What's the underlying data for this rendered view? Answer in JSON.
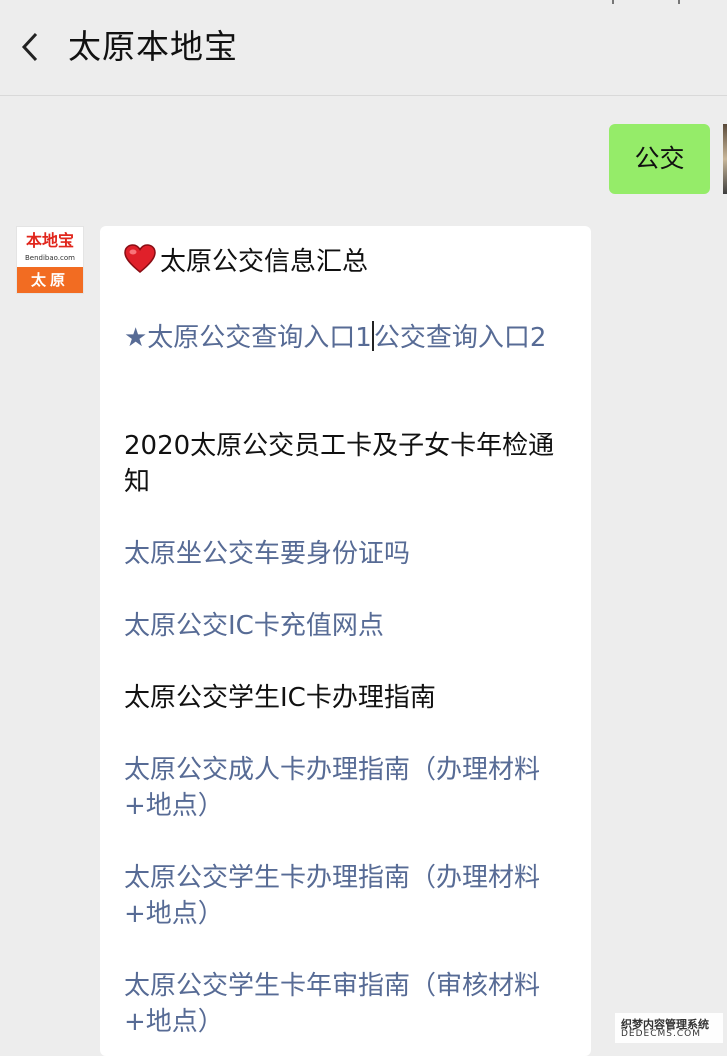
{
  "header": {
    "title": "太原本地宝",
    "back_icon": "chevron-left-icon"
  },
  "sent_message": {
    "text": "公交",
    "bubble_color": "#95ec69"
  },
  "sender": {
    "logo_text": "本地宝",
    "logo_sub": "Bendibao.com",
    "city_label": "太原",
    "brand_color": "#f26c22"
  },
  "received": {
    "header_emoji": "heart-icon",
    "heading": "太原公交信息汇总",
    "link_color": "#576b95",
    "items": [
      {
        "text_a": "★太原公交查询入口1",
        "text_b": "公交查询入口2",
        "type": "link"
      },
      {
        "text": "2020太原公交员工卡及子女卡年检通知",
        "type": "text"
      },
      {
        "text": "太原坐公交车要身份证吗",
        "type": "link"
      },
      {
        "text": "太原公交IC卡充值网点",
        "type": "link"
      },
      {
        "text": "太原公交学生IC卡办理指南",
        "type": "text"
      },
      {
        "text": "太原公交成人卡办理指南（办理材料+地点）",
        "type": "link"
      },
      {
        "text": "太原公交学生卡办理指南（办理材料+地点）",
        "type": "link"
      },
      {
        "text": "太原公交学生卡年审指南（审核材料+地点）",
        "type": "link"
      }
    ]
  },
  "watermark": {
    "line1": "织梦内容管理系统",
    "line2": "DEDECMS.COM"
  }
}
